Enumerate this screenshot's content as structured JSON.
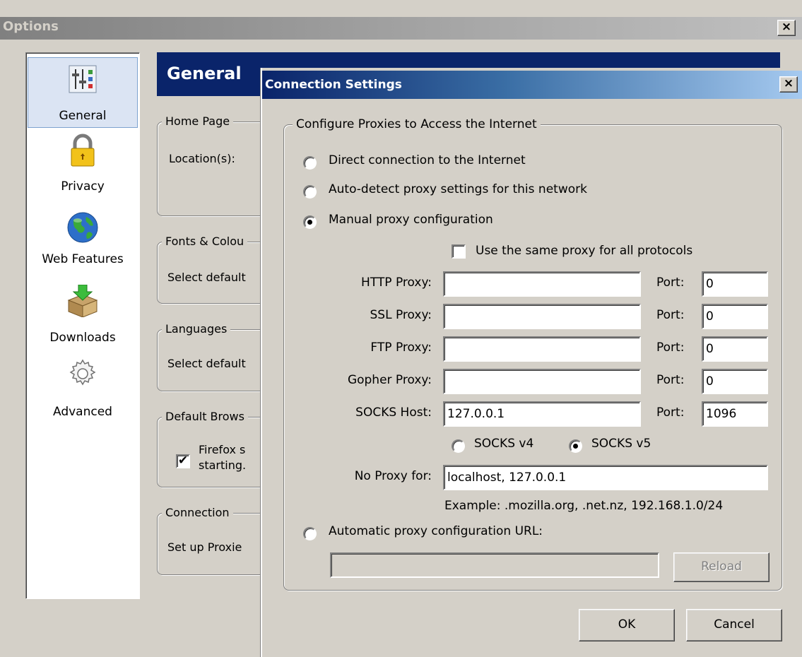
{
  "options_window": {
    "title": "Options",
    "close_label": "×",
    "sidebar": [
      {
        "label": "General",
        "icon": "general-sliders-icon",
        "selected": true
      },
      {
        "label": "Privacy",
        "icon": "padlock-icon"
      },
      {
        "label": "Web Features",
        "icon": "globe-icon"
      },
      {
        "label": "Downloads",
        "icon": "download-box-icon"
      },
      {
        "label": "Advanced",
        "icon": "gear-icon"
      }
    ],
    "header": "General",
    "home_page": {
      "legend": "Home Page",
      "locations_label": "Location(s):"
    },
    "fonts": {
      "legend": "Fonts & Colou",
      "text": "Select default"
    },
    "languages": {
      "legend": "Languages",
      "text": "Select default"
    },
    "default_browser": {
      "legend": "Default Brows",
      "check_line1": "Firefox s",
      "check_line2": "starting.",
      "checked": true
    },
    "connection": {
      "legend": "Connection",
      "text": "Set up Proxie"
    }
  },
  "connection_dialog": {
    "title": "Connection Settings",
    "close_label": "×",
    "group_legend": "Configure Proxies to Access the Internet",
    "direct": "Direct connection to the Internet",
    "auto_detect": "Auto-detect proxy settings for this network",
    "manual": "Manual proxy configuration",
    "same_proxy": "Use the same proxy for all protocols",
    "http_label": "HTTP Proxy:",
    "ssl_label": "SSL Proxy:",
    "ftp_label": "FTP Proxy:",
    "gopher_label": "Gopher Proxy:",
    "socks_label": "SOCKS Host:",
    "port_label": "Port:",
    "http_value": "",
    "ssl_value": "",
    "ftp_value": "",
    "gopher_value": "",
    "socks_value": "127.0.0.1",
    "http_port": "0",
    "ssl_port": "0",
    "ftp_port": "0",
    "gopher_port": "0",
    "socks_port": "1096",
    "socks_v4": "SOCKS v4",
    "socks_v5": "SOCKS v5",
    "no_proxy_label": "No Proxy for:",
    "no_proxy_value": "localhost, 127.0.0.1",
    "example": "Example: .mozilla.org, .net.nz, 192.168.1.0/24",
    "auto_url": "Automatic proxy configuration URL:",
    "auto_url_value": "",
    "reload": "Reload",
    "ok": "OK",
    "cancel": "Cancel",
    "selected_mode": "manual",
    "socks_version": "v5"
  }
}
